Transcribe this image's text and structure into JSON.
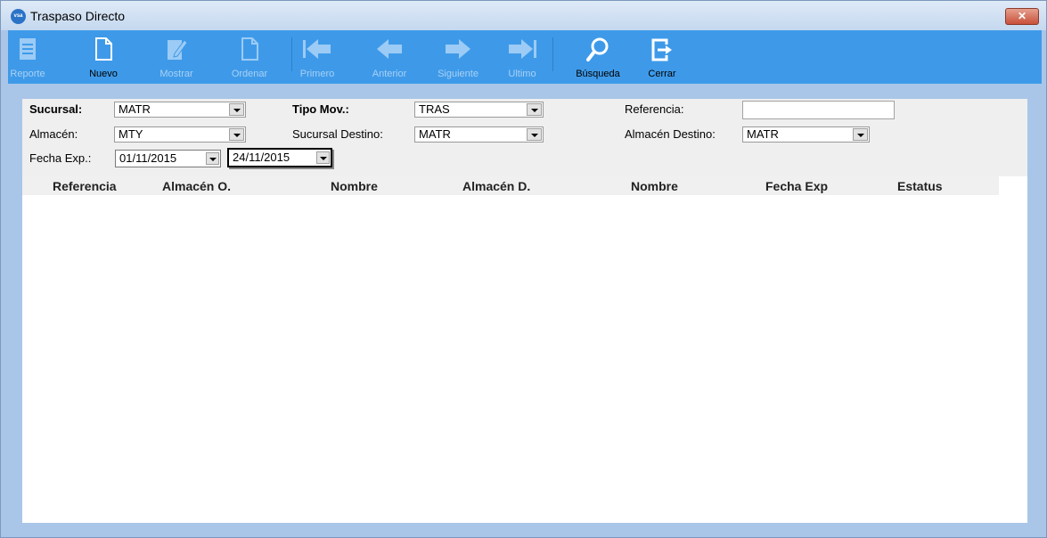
{
  "window": {
    "title": "Traspaso Directo",
    "app_icon_text": "vsa",
    "close_symbol": "✕"
  },
  "toolbar": {
    "reporte": "Reporte",
    "nuevo": "Nuevo",
    "mostrar": "Mostrar",
    "ordenar": "Ordenar",
    "primero": "Primero",
    "anterior": "Anterior",
    "siguiente": "Siguiente",
    "ultimo": "Ultimo",
    "busqueda": "Búsqueda",
    "cerrar": "Cerrar"
  },
  "filters": {
    "sucursal_label": "Sucursal:",
    "sucursal_value": "MATR",
    "tipo_mov_label": "Tipo Mov.:",
    "tipo_mov_value": "TRAS",
    "referencia_label": "Referencia:",
    "referencia_value": "",
    "almacen_label": "Almacén:",
    "almacen_value": "MTY",
    "sucursal_destino_label": "Sucursal Destino:",
    "sucursal_destino_value": "MATR",
    "almacen_destino_label": "Almacén Destino:",
    "almacen_destino_value": "MATR",
    "fecha_exp_label": "Fecha Exp.:",
    "fecha_desde": "01/11/2015",
    "fecha_hasta": "24/11/2015"
  },
  "grid": {
    "columns": [
      "Referencia",
      "Almacén O.",
      "Nombre",
      "Almacén D.",
      "Nombre",
      "Fecha Exp",
      "Estatus"
    ],
    "rows": []
  },
  "colors": {
    "toolbar": "#3e9ae9",
    "frame": "#a9c6e8",
    "disabled_label": "#a9d0f5"
  }
}
